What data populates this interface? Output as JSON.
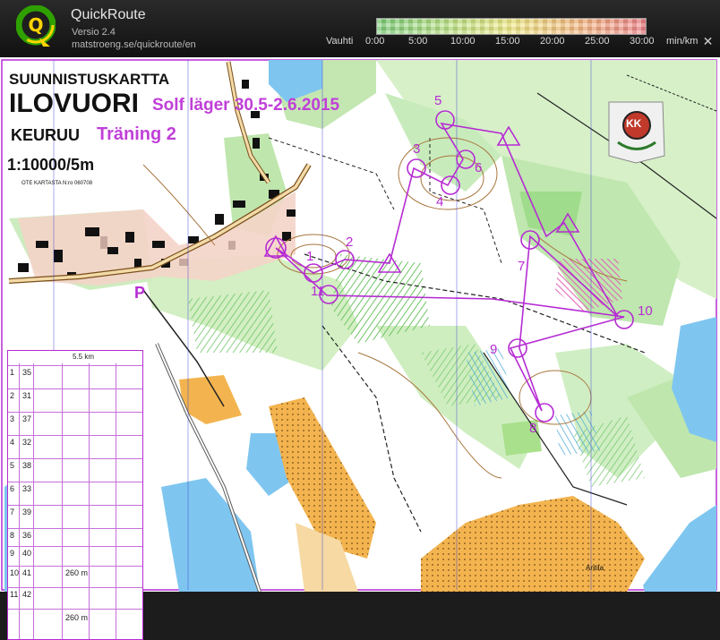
{
  "app": {
    "title": "QuickRoute",
    "version": "Versio 2.4",
    "url": "matstroeng.se/quickroute/en"
  },
  "pace_scale": {
    "label": "Vauhti",
    "ticks": [
      "0:00",
      "5:00",
      "10:00",
      "15:00",
      "20:00",
      "25:00",
      "30:00"
    ],
    "unit": "min/km",
    "colors": [
      "#8bd98a",
      "#f3e98a",
      "#f08d8d"
    ]
  },
  "map": {
    "header": {
      "line1": "SUUNNISTUSKARTTA",
      "line2": "ILOVUORI",
      "line3": "KEURUU",
      "scale": "1:10000/5m",
      "small": "OTE KARTASTA N:ro 060708",
      "event": "Solf läger 30.5-2.6.2015",
      "training": "Träning 2"
    },
    "club_logo": "KK",
    "parking": "P",
    "place_label": "Antila",
    "controls": [
      "1",
      "2",
      "3",
      "4",
      "5",
      "6",
      "7",
      "8",
      "9",
      "10",
      "11"
    ],
    "description_sheet": {
      "course": "5.5 km",
      "length_row1": "260 m",
      "length_row2": "260 m",
      "rows": [
        {
          "n": "1",
          "code": "35"
        },
        {
          "n": "2",
          "code": "31"
        },
        {
          "n": "3",
          "code": "37"
        },
        {
          "n": "4",
          "code": "32"
        },
        {
          "n": "5",
          "code": "38"
        },
        {
          "n": "6",
          "code": "33"
        },
        {
          "n": "7",
          "code": "39"
        },
        {
          "n": "8",
          "code": "36"
        },
        {
          "n": "9",
          "code": "40"
        },
        {
          "n": "10",
          "code": "41"
        },
        {
          "n": "11",
          "code": "42"
        }
      ]
    }
  }
}
